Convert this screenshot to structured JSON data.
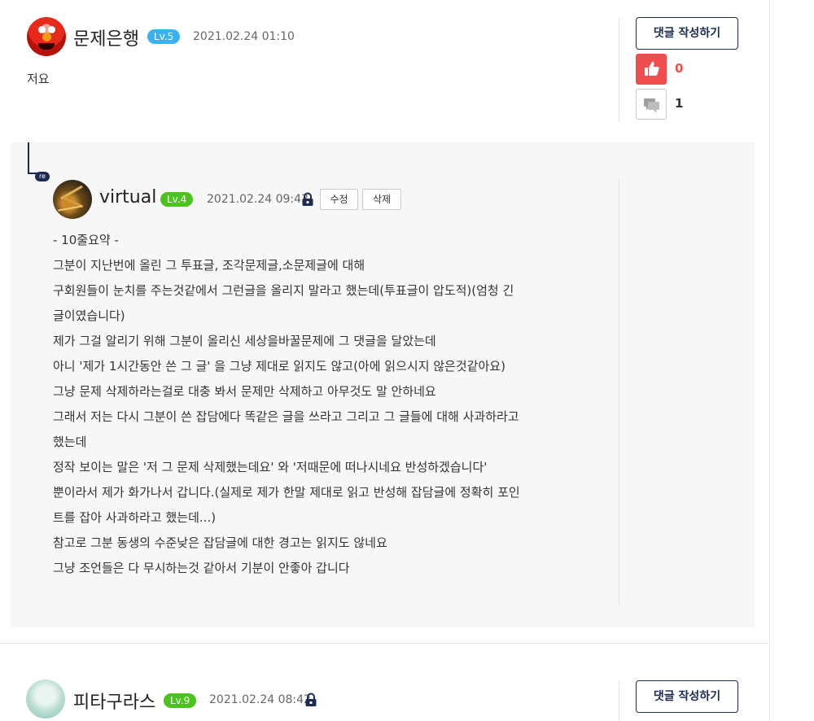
{
  "comments": [
    {
      "username": "문제은행",
      "level": "Lv.5",
      "timestamp": "2021.02.24 01:10",
      "text": "저요",
      "reply_button": "댓글 작성하기",
      "likes": "0",
      "reply_count": "1",
      "level_color": "#3bb2f0"
    },
    {
      "username": "피타구라스",
      "level": "Lv.9",
      "timestamp": "2021.02.24 08:42",
      "reply_button": "댓글 작성하기",
      "level_color": "#4cc21e"
    }
  ],
  "reply": {
    "badge": "re",
    "username": "virtual",
    "level": "Lv.4",
    "timestamp": "2021.02.24 09:43",
    "edit_label": "수정",
    "delete_label": "삭제",
    "lines": [
      "- 10줄요약 -",
      "그분이 지난번에 올린 그 투표글, 조각문제글,소문제글에 대해",
      "구회원들이 눈치를 주는것같에서 그런글을 올리지 말라고 했는데(투표글이 압도적)(엄청 긴",
      "글이였습니다)",
      "제가 그걸 알리기 위해 그분이 올리신 세상을바꿀문제에 그 댓글을 달았는데",
      "아니 '제가 1시간동안 쓴 그 글' 을 그냥 제대로 읽지도 않고(아에 읽으시지 않은것같아요)",
      "그냥 문제 삭제하라는걸로 대충 봐서 문제만 삭제하고 아무것도 말 안하네요",
      "그래서 저는 다시 그분이 쓴 잡담에다 똑같은 글을 쓰라고 그리고 그 글들에 대해 사과하라고",
      "했는데",
      "정작 보이는 말은 '저 그 문제 삭제했는데요' 와 '저때문에 떠나시네요 반성하겠습니다'",
      "뿐이라서 제가 화가나서 갑니다.(실제로 제가 한말 제대로 읽고 반성해 잡담글에 정확히 포인",
      "트를 잡아 사과하라고 했는데...)",
      "참고로 그분 동생의 수준낮은 잡담글에 대한 경고는 읽지도 않네요",
      "그냥 조언들은 다 무시하는것 같아서 기분이 안좋아 갑니다"
    ]
  },
  "colors": {
    "accent_navy": "#1d2b52",
    "like_red": "#f04e4e",
    "panel_bg": "#f7f7f7"
  },
  "icons": [
    "thumbs-up-icon",
    "speech-bubble-icon",
    "lock-icon"
  ]
}
